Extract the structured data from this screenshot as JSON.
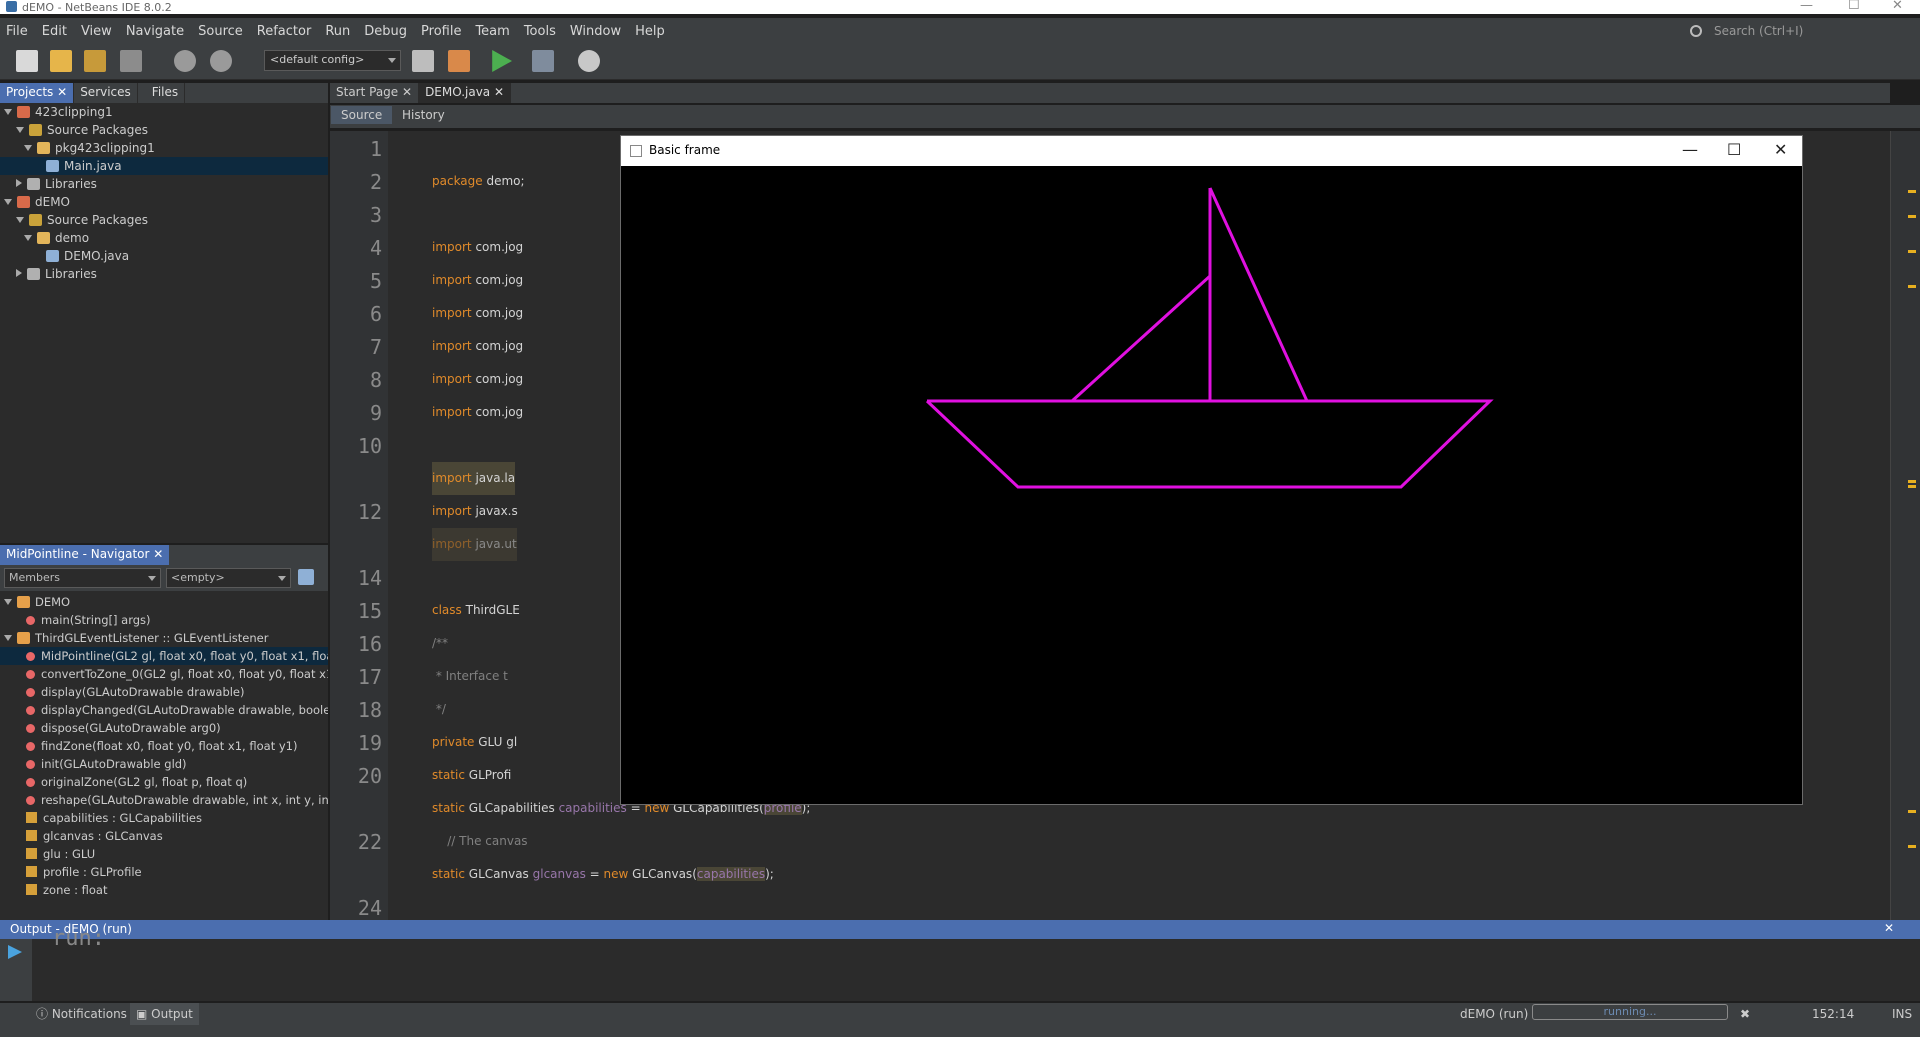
{
  "window": {
    "title": "dEMO - NetBeans IDE 8.0.2"
  },
  "menu": [
    "File",
    "Edit",
    "View",
    "Navigate",
    "Source",
    "Refactor",
    "Run",
    "Debug",
    "Profile",
    "Team",
    "Tools",
    "Window",
    "Help"
  ],
  "search": {
    "placeholder": "Search (Ctrl+I)"
  },
  "toolbar": {
    "config": "<default config>"
  },
  "project_tabs": [
    "Projects",
    "Services",
    "Files"
  ],
  "project_tree": [
    {
      "label": "423clipping1"
    },
    {
      "label": "Source Packages"
    },
    {
      "label": "pkg423clipping1"
    },
    {
      "label": "Main.java"
    },
    {
      "label": "Libraries"
    },
    {
      "label": "dEMO"
    },
    {
      "label": "Source Packages"
    },
    {
      "label": "demo"
    },
    {
      "label": "DEMO.java"
    },
    {
      "label": "Libraries"
    }
  ],
  "navigator": {
    "title": "MidPointline - Navigator",
    "filter": "Members",
    "empty": "<empty>",
    "items": [
      {
        "label": "DEMO"
      },
      {
        "label": "main(String[] args)"
      },
      {
        "label": "ThirdGLEventListener :: GLEventListener"
      },
      {
        "label": "MidPointline(GL2 gl, float x0, float y0, float x1, float y1"
      },
      {
        "label": "convertToZone_0(GL2 gl, float x0, float y0, float x1, flo"
      },
      {
        "label": "display(GLAutoDrawable drawable)"
      },
      {
        "label": "displayChanged(GLAutoDrawable drawable, boolea"
      },
      {
        "label": "dispose(GLAutoDrawable arg0)"
      },
      {
        "label": "findZone(float x0, float y0, float x1, float y1)"
      },
      {
        "label": "init(GLAutoDrawable gld)"
      },
      {
        "label": "originalZone(GL2 gl, float p, float q)"
      },
      {
        "label": "reshape(GLAutoDrawable drawable, int x, int y, int w"
      },
      {
        "label": "capabilities : GLCapabilities"
      },
      {
        "label": "glcanvas : GLCanvas"
      },
      {
        "label": "glu : GLU"
      },
      {
        "label": "profile : GLProfile"
      },
      {
        "label": "zone : float"
      }
    ]
  },
  "editor": {
    "tabs": [
      "Start Page",
      "DEMO.java"
    ],
    "source_label": "Source",
    "history_label": "History",
    "line_numbers": [
      "1",
      "2",
      "3",
      "4",
      "5",
      "6",
      "7",
      "8",
      "9",
      "10",
      "12",
      "14",
      "15",
      "16",
      "17",
      "18",
      "19",
      "20",
      "22",
      "24"
    ],
    "lines": [
      {
        "kw": "package",
        "rest": " demo;"
      },
      {
        "kw": "import",
        "rest": " com.jog"
      },
      {
        "kw": "import",
        "rest": " com.jog"
      },
      {
        "kw": "import",
        "rest": " com.jog"
      },
      {
        "kw": "import",
        "rest": " com.jog"
      },
      {
        "kw": "import",
        "rest": " com.jog"
      },
      {
        "kw": "import",
        "rest": " com.jog"
      },
      {
        "kw": "import",
        "rest": " java.la"
      },
      {
        "kw": "import",
        "rest": " javax.s"
      },
      {
        "kw": "import",
        "rest": " java.ut"
      },
      {
        "kw": "class",
        "rest": " ThirdGLE"
      },
      {
        "cmt": "/**"
      },
      {
        "cmt": " * Interface t"
      },
      {
        "cmt": " */"
      },
      {
        "kw": "private",
        "rest": " GLU gl"
      },
      {
        "kw": "static",
        "rest": " GLProfi"
      },
      {
        "kw": "static",
        "rest": " GLCapabilities ",
        "fv": "capabilities",
        "rest2": " = ",
        "kw2": "new",
        "rest3": " GLCapabilities(",
        "hl": "profile",
        "rest4": ");"
      },
      {
        "cmt": "    // The canvas"
      },
      {
        "kw": "static",
        "rest": " GLCanvas ",
        "fv": "glcanvas",
        "rest2": " = ",
        "kw2": "new",
        "rest3": " GLCanvas(",
        "hl": "capabilities",
        "rest4": ");"
      }
    ]
  },
  "frame": {
    "title": "Basic frame"
  },
  "output": {
    "title": "Output - dEMO (run)",
    "text": "run:"
  },
  "status": {
    "notifications": "Notifications",
    "output": "Output",
    "run_label": "dEMO (run)",
    "progress": "running...",
    "position": "152:14",
    "mode": "INS"
  },
  "colors": {
    "accent": "#4b6eaf",
    "boat": "#e010e0",
    "keyword": "#e08a2a"
  }
}
